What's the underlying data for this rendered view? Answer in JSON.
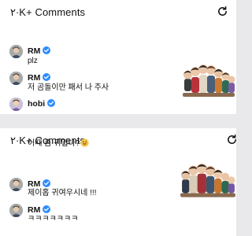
{
  "colors": {
    "verified": "#2d8cff",
    "background": "#e9e9ec",
    "panel": "#ffffff"
  },
  "top_panel": {
    "title": "۲·K+ Comments",
    "refresh_icon": "refresh-icon",
    "comments": [
      {
        "author": "RM",
        "verified": true,
        "text": "plz",
        "avatar": "rm-avatar"
      },
      {
        "author": "RM",
        "verified": true,
        "text": "저 곰돌이만 패서 나 주사",
        "avatar": "rm-avatar"
      },
      {
        "author": "hobi",
        "verified": true,
        "text": "",
        "avatar": "hobi-avatar"
      }
    ]
  },
  "bottom_panel": {
    "title": "۲·K+ Comments",
    "refresh_icon": "refresh-icon",
    "comments": [
      {
        "author": "",
        "text": "어때 좀 귀엽나?",
        "emoji": "grinning-face-icon"
      },
      {
        "author": "RM",
        "verified": true,
        "text": "제이홉 귀여우시네 !!!",
        "avatar": "rm-avatar"
      },
      {
        "author": "RM",
        "verified": true,
        "text": "ㅋㅋㅋㅋㅋㅋㅋ",
        "avatar": "rm-avatar"
      }
    ]
  }
}
